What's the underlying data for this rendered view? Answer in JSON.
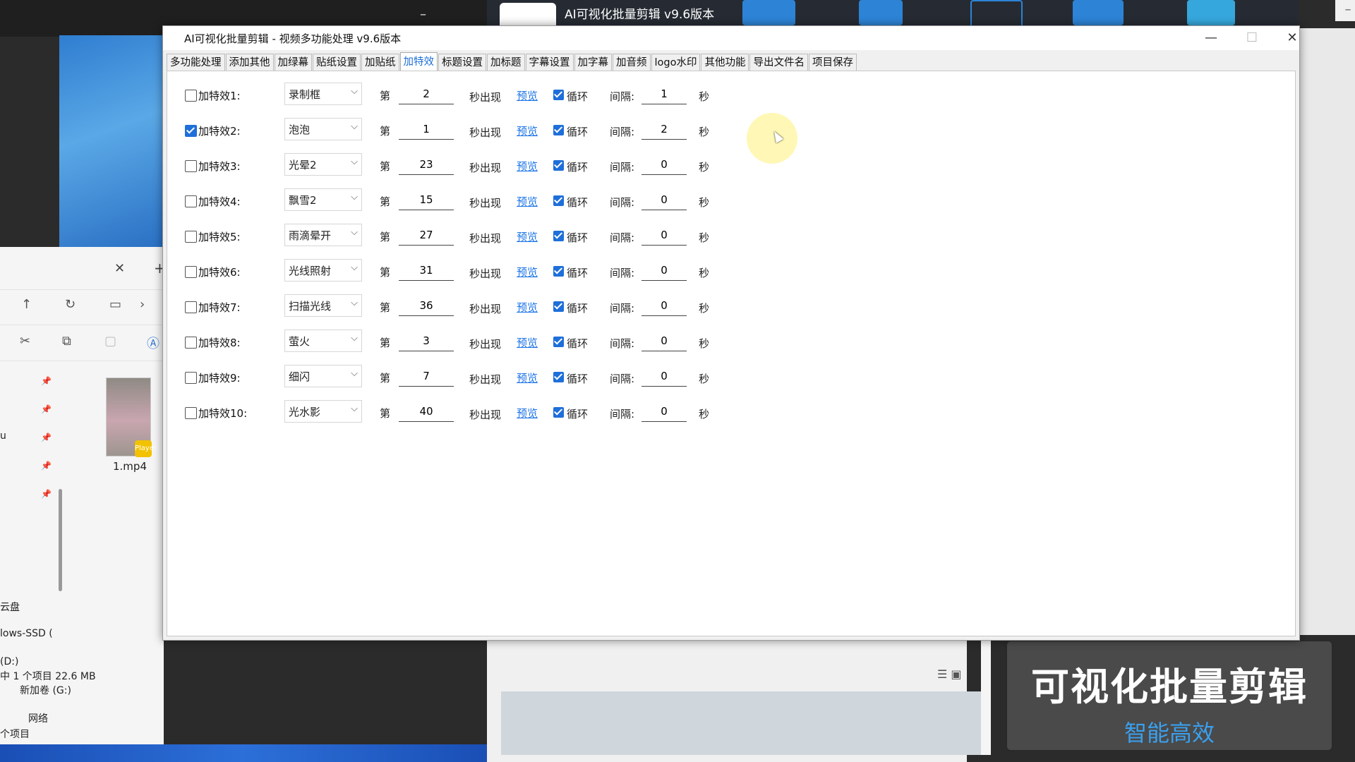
{
  "background": {
    "explorer": {
      "thumbnail_name": "1.mp4",
      "thumbnail_badge": "Player",
      "side_items": [
        "u",
        "云盘",
        "lows-SSD (",
        "(D:)",
        "新加卷 (G:)",
        "网络"
      ],
      "status_text": "中 1 个项目  22.6 MB",
      "status_text2": "个项目"
    },
    "right_app": {
      "title": "AI可视化批量剪辑 v9.6版本"
    },
    "promo": {
      "headline": "可视化批量剪辑",
      "tagline": "智能高效"
    }
  },
  "dialog": {
    "title": "AI可视化批量剪辑 - 视频多功能处理  v9.6版本",
    "tabs": [
      "多功能处理",
      "添加其他",
      "加绿幕",
      "贴纸设置",
      "加贴纸",
      "加特效",
      "标题设置",
      "加标题",
      "字幕设置",
      "加字幕",
      "加音频",
      "logo水印",
      "其他功能",
      "导出文件名",
      "项目保存"
    ],
    "active_tab": "加特效",
    "common": {
      "di": "第",
      "chuxian": "秒出现",
      "preview": "预览",
      "loop": "循环",
      "interval": "间隔:",
      "sec": "秒"
    },
    "effects": [
      {
        "label": "加特效1:",
        "checked": false,
        "effect": "录制框",
        "start": "2",
        "loop": true,
        "interval": "1"
      },
      {
        "label": "加特效2:",
        "checked": true,
        "effect": "泡泡",
        "start": "1",
        "loop": true,
        "interval": "2"
      },
      {
        "label": "加特效3:",
        "checked": false,
        "effect": "光晕2",
        "start": "23",
        "loop": true,
        "interval": "0"
      },
      {
        "label": "加特效4:",
        "checked": false,
        "effect": "飘雪2",
        "start": "15",
        "loop": true,
        "interval": "0"
      },
      {
        "label": "加特效5:",
        "checked": false,
        "effect": "雨滴晕开",
        "start": "27",
        "loop": true,
        "interval": "0"
      },
      {
        "label": "加特效6:",
        "checked": false,
        "effect": "光线照射",
        "start": "31",
        "loop": true,
        "interval": "0"
      },
      {
        "label": "加特效7:",
        "checked": false,
        "effect": "扫描光线",
        "start": "36",
        "loop": true,
        "interval": "0"
      },
      {
        "label": "加特效8:",
        "checked": false,
        "effect": "萤火",
        "start": "3",
        "loop": true,
        "interval": "0"
      },
      {
        "label": "加特效9:",
        "checked": false,
        "effect": "细闪",
        "start": "7",
        "loop": true,
        "interval": "0"
      },
      {
        "label": "加特效10:",
        "checked": false,
        "effect": "光水影",
        "start": "40",
        "loop": true,
        "interval": "0"
      }
    ]
  },
  "colors": {
    "accent": "#1e6fd9",
    "link": "#1a73e8",
    "promo_tagline": "#3aa0ee"
  }
}
